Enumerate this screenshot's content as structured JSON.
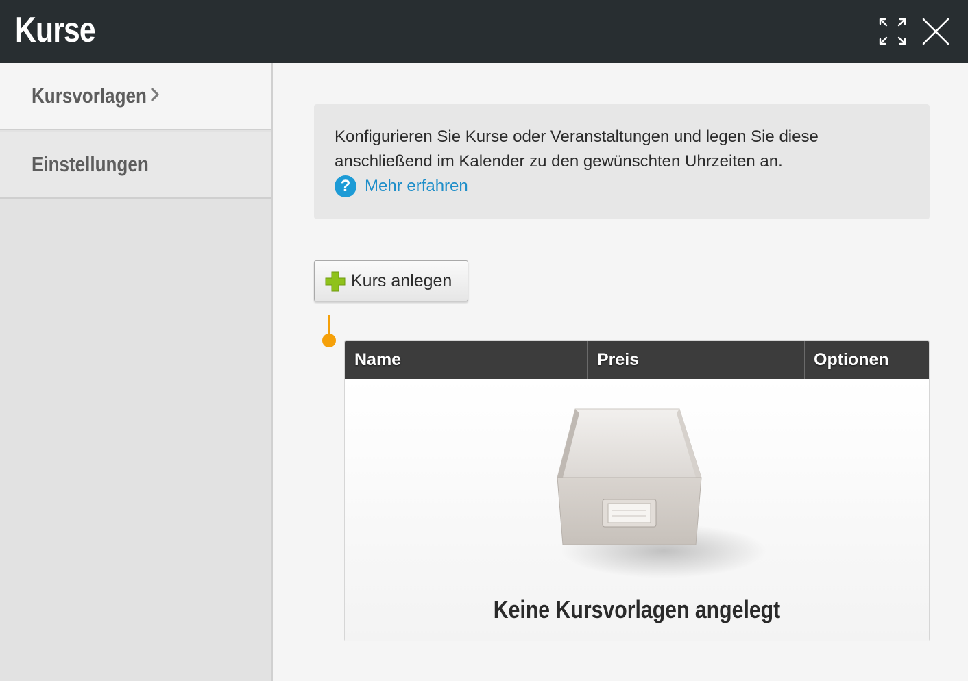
{
  "header": {
    "title": "Kurse",
    "expand_icon": "expand-arrows-icon",
    "close_icon": "close-x-icon"
  },
  "sidebar": {
    "items": [
      {
        "label": "Kursvorlagen",
        "active": true,
        "icon": "chevron-right-icon"
      },
      {
        "label": "Einstellungen",
        "active": false
      }
    ]
  },
  "info": {
    "text": "Konfigurieren Sie Kurse oder Veranstaltungen und legen Sie diese anschließend im Kalender zu den gewünschten Uhrzeiten an.",
    "help_icon_glyph": "?",
    "more_link": "Mehr erfahren"
  },
  "toolbar": {
    "add_label": "Kurs anlegen",
    "add_icon": "plus-icon"
  },
  "table": {
    "columns": [
      "Name",
      "Preis",
      "Optionen"
    ],
    "rows": [],
    "empty_message": "Keine Kursvorlagen angelegt",
    "empty_icon": "empty-drawer-icon"
  },
  "colors": {
    "header_bg": "#282e31",
    "link": "#1e8ec9",
    "help_icon": "#1d9bd6",
    "plus_icon": "#8fc21b",
    "marker": "#f5a009",
    "table_header_bg": "#3c3c3c"
  }
}
